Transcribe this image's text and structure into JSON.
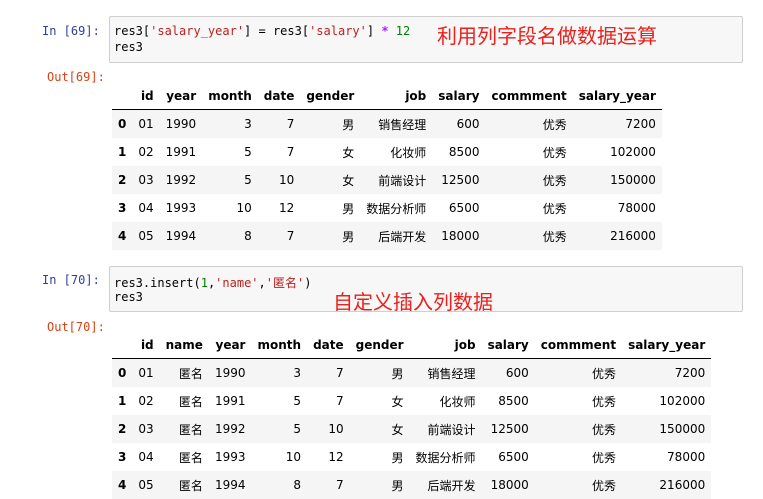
{
  "cell1": {
    "in_prompt": "In  [69]:",
    "line1": {
      "a": "res3[",
      "s1": "'salary_year'",
      "b": "] = res3[",
      "s2": "'salary'",
      "c": "] ",
      "op": "*",
      "d": " ",
      "n": "12"
    },
    "line2": "res3",
    "annotation": "利用列字段名做数据运算",
    "out_prompt": "Out[69]:",
    "table": {
      "columns": [
        "",
        "id",
        "year",
        "month",
        "date",
        "gender",
        "job",
        "salary",
        "commment",
        "salary_year"
      ],
      "rows": [
        [
          "0",
          "01",
          "1990",
          "3",
          "7",
          "男",
          "销售经理",
          "600",
          "优秀",
          "7200"
        ],
        [
          "1",
          "02",
          "1991",
          "5",
          "7",
          "女",
          "化妆师",
          "8500",
          "优秀",
          "102000"
        ],
        [
          "2",
          "03",
          "1992",
          "5",
          "10",
          "女",
          "前端设计",
          "12500",
          "优秀",
          "150000"
        ],
        [
          "3",
          "04",
          "1993",
          "10",
          "12",
          "男",
          "数据分析师",
          "6500",
          "优秀",
          "78000"
        ],
        [
          "4",
          "05",
          "1994",
          "8",
          "7",
          "男",
          "后端开发",
          "18000",
          "优秀",
          "216000"
        ]
      ]
    }
  },
  "cell2": {
    "in_prompt": "In  [70]:",
    "line1": {
      "a": "res3.insert(",
      "n": "1",
      "b": ",",
      "s1": "'name'",
      "c": ",",
      "s2": "'匿名'",
      "d": ")"
    },
    "line2": "res3",
    "annotation": "自定义插入列数据",
    "out_prompt": "Out[70]:",
    "table": {
      "columns": [
        "",
        "id",
        "name",
        "year",
        "month",
        "date",
        "gender",
        "job",
        "salary",
        "commment",
        "salary_year"
      ],
      "rows": [
        [
          "0",
          "01",
          "匿名",
          "1990",
          "3",
          "7",
          "男",
          "销售经理",
          "600",
          "优秀",
          "7200"
        ],
        [
          "1",
          "02",
          "匿名",
          "1991",
          "5",
          "7",
          "女",
          "化妆师",
          "8500",
          "优秀",
          "102000"
        ],
        [
          "2",
          "03",
          "匿名",
          "1992",
          "5",
          "10",
          "女",
          "前端设计",
          "12500",
          "优秀",
          "150000"
        ],
        [
          "3",
          "04",
          "匿名",
          "1993",
          "10",
          "12",
          "男",
          "数据分析师",
          "6500",
          "优秀",
          "78000"
        ],
        [
          "4",
          "05",
          "匿名",
          "1994",
          "8",
          "7",
          "男",
          "后端开发",
          "18000",
          "优秀",
          "216000"
        ]
      ]
    }
  }
}
